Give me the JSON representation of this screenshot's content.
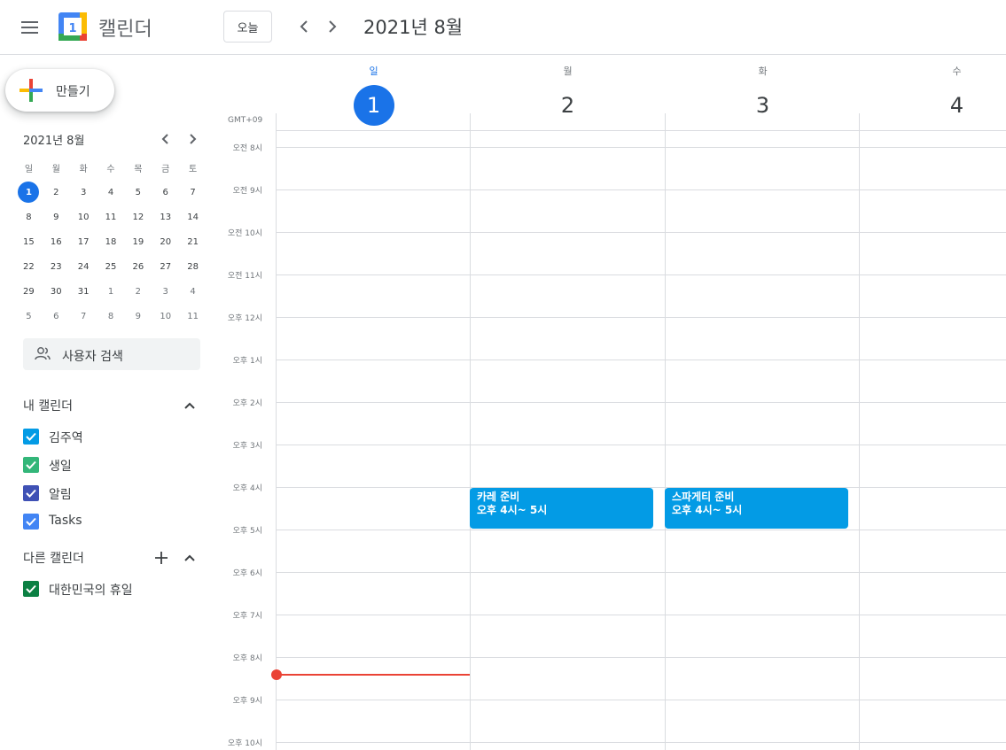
{
  "header": {
    "app_title": "캘린더",
    "logo_day": "1",
    "today_label": "오늘",
    "period": "2021년 8월"
  },
  "sidebar": {
    "create_label": "만들기",
    "mini_calendar": {
      "title": "2021년 8월",
      "weekdays": [
        "일",
        "월",
        "화",
        "수",
        "목",
        "금",
        "토"
      ],
      "weeks": [
        [
          "1",
          "2",
          "3",
          "4",
          "5",
          "6",
          "7"
        ],
        [
          "8",
          "9",
          "10",
          "11",
          "12",
          "13",
          "14"
        ],
        [
          "15",
          "16",
          "17",
          "18",
          "19",
          "20",
          "21"
        ],
        [
          "22",
          "23",
          "24",
          "25",
          "26",
          "27",
          "28"
        ],
        [
          "29",
          "30",
          "31",
          "1",
          "2",
          "3",
          "4"
        ],
        [
          "5",
          "6",
          "7",
          "8",
          "9",
          "10",
          "11"
        ]
      ]
    },
    "people_search": "사용자 검색",
    "my_calendars": {
      "title": "내 캘린더",
      "items": [
        {
          "label": "김주역",
          "color": "#039be5"
        },
        {
          "label": "생일",
          "color": "#33b679"
        },
        {
          "label": "알림",
          "color": "#3f51b5"
        },
        {
          "label": "Tasks",
          "color": "#4285f4"
        }
      ]
    },
    "other_calendars": {
      "title": "다른 캘린더",
      "items": [
        {
          "label": "대한민국의 휴일",
          "color": "#0b8043"
        }
      ]
    }
  },
  "week": {
    "timezone": "GMT+09",
    "days": [
      {
        "name": "일",
        "num": "1",
        "active": true
      },
      {
        "name": "월",
        "num": "2",
        "active": false
      },
      {
        "name": "화",
        "num": "3",
        "active": false
      },
      {
        "name": "수",
        "num": "4",
        "active": false
      }
    ],
    "hours": [
      "오전 8시",
      "오전 9시",
      "오전 10시",
      "오전 11시",
      "오후 12시",
      "오후 1시",
      "오후 2시",
      "오후 3시",
      "오후 4시",
      "오후 5시",
      "오후 6시",
      "오후 7시",
      "오후 8시",
      "오후 9시",
      "오후 10시"
    ],
    "events": [
      {
        "title": "카레 준비",
        "time": "오후 4시~ 5시",
        "day": 1,
        "color": "#039be5"
      },
      {
        "title": "스파게티 준비",
        "time": "오후 4시~ 5시",
        "day": 2,
        "color": "#039be5"
      }
    ]
  },
  "colors": {
    "accent": "#1a73e8",
    "now_line": "#ea4335"
  }
}
